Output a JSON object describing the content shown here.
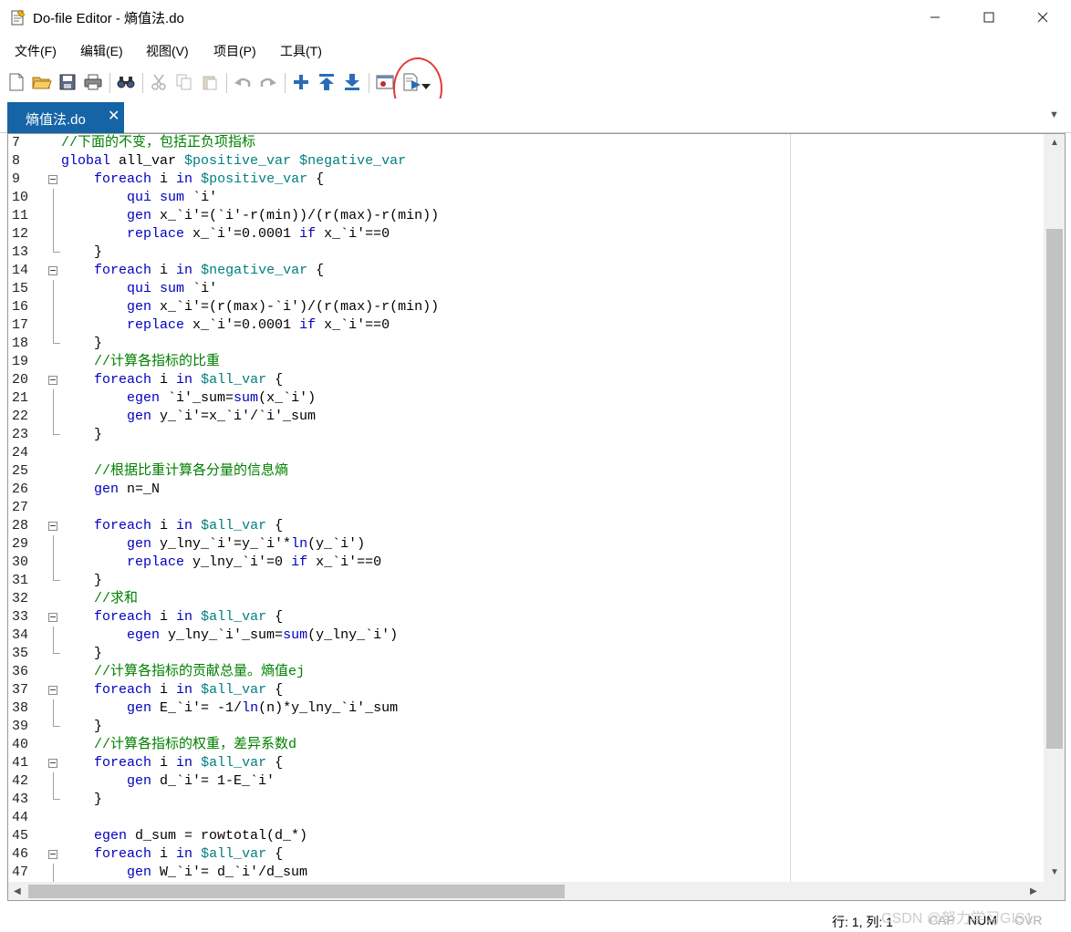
{
  "window": {
    "title": "Do-file Editor - 熵值法.do"
  },
  "menu": [
    "文件(F)",
    "编辑(E)",
    "视图(V)",
    "项目(P)",
    "工具(T)"
  ],
  "tab": {
    "label": "熵值法.do"
  },
  "code_lines": [
    {
      "n": "7",
      "t": "//下面的不变，包括正负项指标",
      "f": ""
    },
    {
      "n": "8",
      "t": "global all_var $positive_var $negative_var",
      "f": ""
    },
    {
      "n": "9",
      "t": "    foreach i in $positive_var {",
      "f": "box"
    },
    {
      "n": "10",
      "t": "        qui sum `i'",
      "f": "line"
    },
    {
      "n": "11",
      "t": "        gen x_`i'=(`i'-r(min))/(r(max)-r(min))",
      "f": "line"
    },
    {
      "n": "12",
      "t": "        replace x_`i'=0.0001 if x_`i'==0",
      "f": "line"
    },
    {
      "n": "13",
      "t": "    }",
      "f": "end"
    },
    {
      "n": "14",
      "t": "    foreach i in $negative_var {",
      "f": "box"
    },
    {
      "n": "15",
      "t": "        qui sum `i'",
      "f": "line"
    },
    {
      "n": "16",
      "t": "        gen x_`i'=(r(max)-`i')/(r(max)-r(min))",
      "f": "line"
    },
    {
      "n": "17",
      "t": "        replace x_`i'=0.0001 if x_`i'==0",
      "f": "line"
    },
    {
      "n": "18",
      "t": "    }",
      "f": "end"
    },
    {
      "n": "19",
      "t": "    //计算各指标的比重",
      "f": ""
    },
    {
      "n": "20",
      "t": "    foreach i in $all_var {",
      "f": "box"
    },
    {
      "n": "21",
      "t": "        egen `i'_sum=sum(x_`i')",
      "f": "line"
    },
    {
      "n": "22",
      "t": "        gen y_`i'=x_`i'/`i'_sum",
      "f": "line"
    },
    {
      "n": "23",
      "t": "    }",
      "f": "end"
    },
    {
      "n": "24",
      "t": "",
      "f": ""
    },
    {
      "n": "25",
      "t": "    //根据比重计算各分量的信息熵",
      "f": ""
    },
    {
      "n": "26",
      "t": "    gen n=_N",
      "f": ""
    },
    {
      "n": "27",
      "t": "",
      "f": ""
    },
    {
      "n": "28",
      "t": "    foreach i in $all_var {",
      "f": "box"
    },
    {
      "n": "29",
      "t": "        gen y_lny_`i'=y_`i'*ln(y_`i')",
      "f": "line"
    },
    {
      "n": "30",
      "t": "        replace y_lny_`i'=0 if x_`i'==0",
      "f": "line"
    },
    {
      "n": "31",
      "t": "    }",
      "f": "end"
    },
    {
      "n": "32",
      "t": "    //求和",
      "f": ""
    },
    {
      "n": "33",
      "t": "    foreach i in $all_var {",
      "f": "box"
    },
    {
      "n": "34",
      "t": "        egen y_lny_`i'_sum=sum(y_lny_`i')",
      "f": "line"
    },
    {
      "n": "35",
      "t": "    }",
      "f": "end"
    },
    {
      "n": "36",
      "t": "    //计算各指标的贡献总量。熵值ej",
      "f": ""
    },
    {
      "n": "37",
      "t": "    foreach i in $all_var {",
      "f": "box"
    },
    {
      "n": "38",
      "t": "        gen E_`i'= -1/ln(n)*y_lny_`i'_sum",
      "f": "line"
    },
    {
      "n": "39",
      "t": "    }",
      "f": "end"
    },
    {
      "n": "40",
      "t": "    //计算各指标的权重，差异系数d",
      "f": ""
    },
    {
      "n": "41",
      "t": "    foreach i in $all_var {",
      "f": "box"
    },
    {
      "n": "42",
      "t": "        gen d_`i'= 1-E_`i'",
      "f": "line"
    },
    {
      "n": "43",
      "t": "    }",
      "f": "end"
    },
    {
      "n": "44",
      "t": "",
      "f": ""
    },
    {
      "n": "45",
      "t": "    egen d_sum = rowtotal(d_*)",
      "f": ""
    },
    {
      "n": "46",
      "t": "    foreach i in $all_var {",
      "f": "box"
    },
    {
      "n": "47",
      "t": "        gen W_`i'= d_`i'/d_sum",
      "f": "line"
    }
  ],
  "status": {
    "position": "行: 1, 列: 1",
    "cap": "CAP",
    "num": "NUM",
    "ovr": "OVR"
  },
  "watermark": "CSDN @努力学习GIS1"
}
